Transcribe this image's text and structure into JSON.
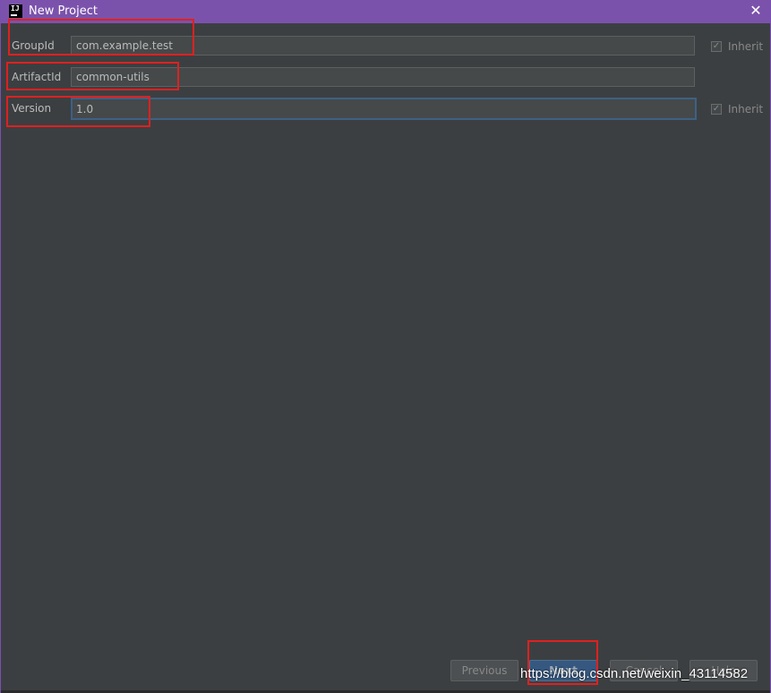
{
  "window": {
    "title": "New Project",
    "app_logo_text": "IJ",
    "close_glyph": "✕"
  },
  "form": {
    "group_id": {
      "label": "GroupId",
      "value": "com.example.test",
      "inherit_label": "Inherit",
      "inherit_checked": true
    },
    "artifact_id": {
      "label": "ArtifactId",
      "value": "common-utils"
    },
    "version": {
      "label": "Version",
      "value": "1.0",
      "inherit_label": "Inherit",
      "inherit_checked": true,
      "focused": true
    }
  },
  "buttons": {
    "previous": "Previous",
    "next": "Next",
    "cancel": "Cancel",
    "help": "Help"
  },
  "checkmark_glyph": "✓",
  "watermark": "https://blog.csdn.net/weixin_43114582",
  "colors": {
    "titlebar": "#7b52ab",
    "panel": "#3c3f41",
    "field": "#45494a",
    "focus_border": "#3d6185",
    "primary_button": "#365880",
    "annotation_red": "#e02020"
  }
}
